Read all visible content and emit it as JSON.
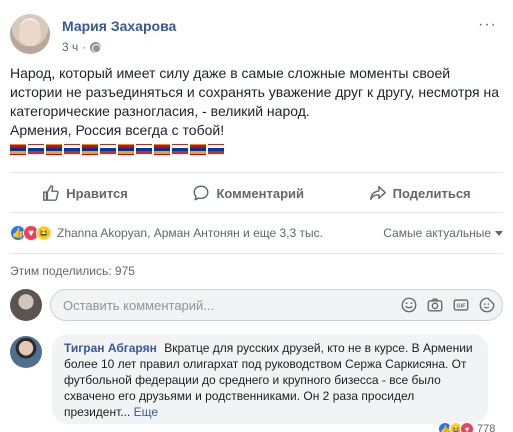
{
  "post": {
    "author": "Мария Захарова",
    "time": "3 ч",
    "more": "···",
    "text_lines": [
      "Народ, который имеет силу даже в самые сложные моменты своей истории не разъединяться и сохранять уважение друг к другу, несмотря на категорические разногласия, - великий народ.",
      "Армения, Россия всегда с тобой!"
    ],
    "flags": [
      "am",
      "ru",
      "am",
      "ru",
      "am",
      "ru",
      "am",
      "ru",
      "am",
      "ru",
      "am",
      "ru"
    ]
  },
  "actions": {
    "like": "Нравится",
    "comment": "Комментарий",
    "share": "Поделиться"
  },
  "reactions": {
    "names": "Zhanna Akopyan, Арман Антонян и еще 3,3 тыс.",
    "sort": "Самые актуальные"
  },
  "shares": "Этим поделились: 975",
  "comment_box": {
    "placeholder": "Оставить комментарий..."
  },
  "comment": {
    "author": "Тигран Абгарян",
    "text": "Вкратце для русских друзей, кто не в курсе. В Армении более 10 лет правил олигархат под руководством Сержа Саркисяна. От футбольной федерации до среднего и крупного бизесса - все было схвачено его друзьями и родственниками. Он 2 раза просидел президент...",
    "see_more": "Еще",
    "reaction_count": "778"
  },
  "colors": {
    "link": "#385898",
    "muted": "#616770",
    "like_blue": "#2078f4"
  }
}
